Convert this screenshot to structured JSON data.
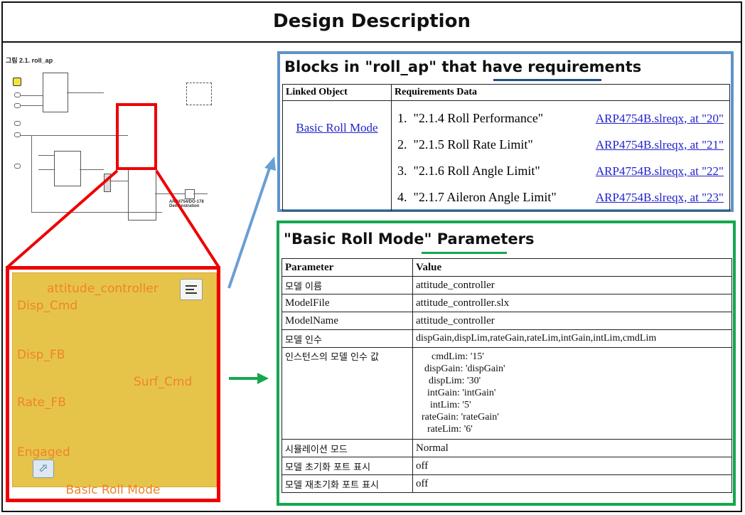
{
  "header": {
    "title": "Design Description"
  },
  "overview": {
    "caption": "그림 2.1. roll_ap",
    "demo_label": "ARP4754/DO-178 Demonstration",
    "block_label": "Basic Roll Mode"
  },
  "block": {
    "title": "attitude_controller",
    "inputs": [
      "Disp_Cmd",
      "Disp_FB",
      "Rate_FB",
      "Engaged"
    ],
    "output": "Surf_Cmd",
    "name": "Basic Roll Mode",
    "fill_color": "#e6c44a",
    "text_color": "#f0842a"
  },
  "requirements_panel": {
    "title": "Blocks in \"roll_ap\" that have requirements",
    "headers": [
      "Linked Object",
      "Requirements Data"
    ],
    "linked_object": "Basic Roll Mode",
    "items": [
      {
        "num": "1.",
        "name": "\"2.1.4 Roll Performance\"",
        "link": "ARP4754B.slreqx, at \"20\""
      },
      {
        "num": "2.",
        "name": "\"2.1.5 Roll Rate Limit\"",
        "link": "ARP4754B.slreqx, at \"21\""
      },
      {
        "num": "3.",
        "name": "\"2.1.6 Roll Angle Limit\"",
        "link": "ARP4754B.slreqx, at \"22\""
      },
      {
        "num": "4.",
        "name": "\"2.1.7 Aileron Angle Limit\"",
        "link": "ARP4754B.slreqx, at \"23\""
      }
    ],
    "border_color": "#5e93c8"
  },
  "parameters_panel": {
    "title": "\"Basic Roll Mode\" Parameters",
    "headers": [
      "Parameter",
      "Value"
    ],
    "rows": [
      {
        "param": "모델 이름",
        "value": "attitude_controller"
      },
      {
        "param": "ModelFile",
        "value": "attitude_controller.slx"
      },
      {
        "param": "ModelName",
        "value": "attitude_controller"
      },
      {
        "param": "모델 인수",
        "value": "dispGain,dispLim,rateGain,rateLim,intGain,intLim,cmdLim"
      }
    ],
    "instance_label": "인스턴스의 모델 인수 값",
    "instance_values": [
      "cmdLim: '15'",
      "dispGain: 'dispGain'",
      "dispLim: '30'",
      "intGain: 'intGain'",
      "intLim: '5'",
      "rateGain: 'rateGain'",
      "rateLim: '6'"
    ],
    "rows_after": [
      {
        "param": "시뮬레이션 모드",
        "value": "Normal"
      },
      {
        "param": "모델 초기화 포트 표시",
        "value": "off"
      },
      {
        "param": "모델 재초기화 포트 표시",
        "value": "off"
      }
    ],
    "border_color": "#14a84e"
  }
}
